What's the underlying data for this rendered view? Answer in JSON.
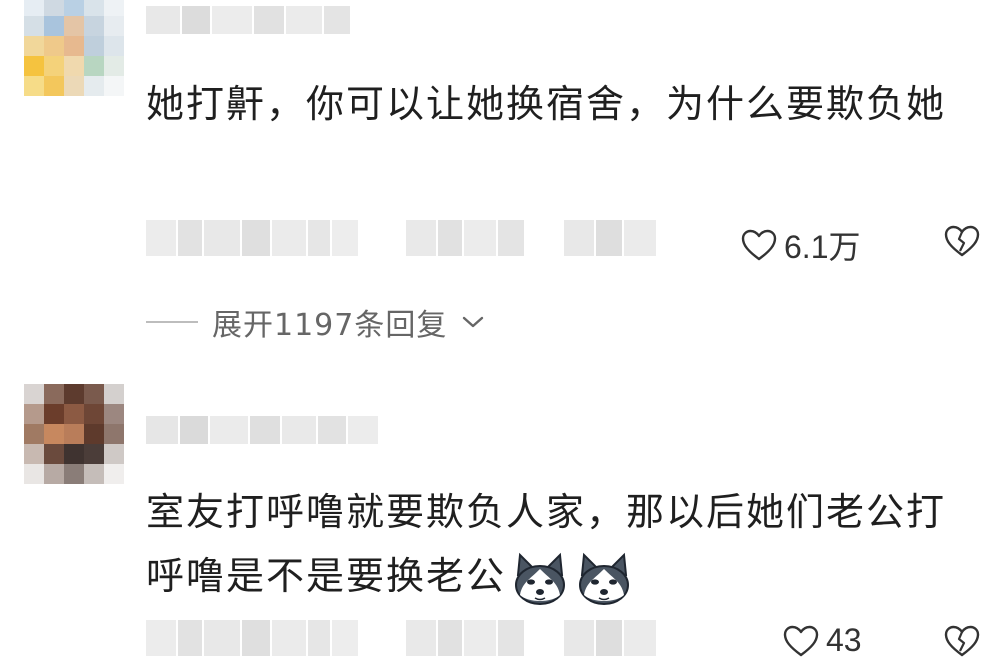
{
  "comments": [
    {
      "text": "她打鼾，你可以让她换宿舍，为什么要欺负她",
      "like_count": "6.1万",
      "expand_replies": "展开1197条回复"
    },
    {
      "text": "室友打呼噜就要欺负人家，那以后她们老公打呼噜是不是要换老公",
      "emojis": [
        "husky-emoji",
        "husky-emoji"
      ],
      "like_count": "43"
    }
  ],
  "icons": {
    "like": "heart-outline-icon",
    "dislike": "broken-heart-icon",
    "expand": "chevron-down-icon"
  }
}
